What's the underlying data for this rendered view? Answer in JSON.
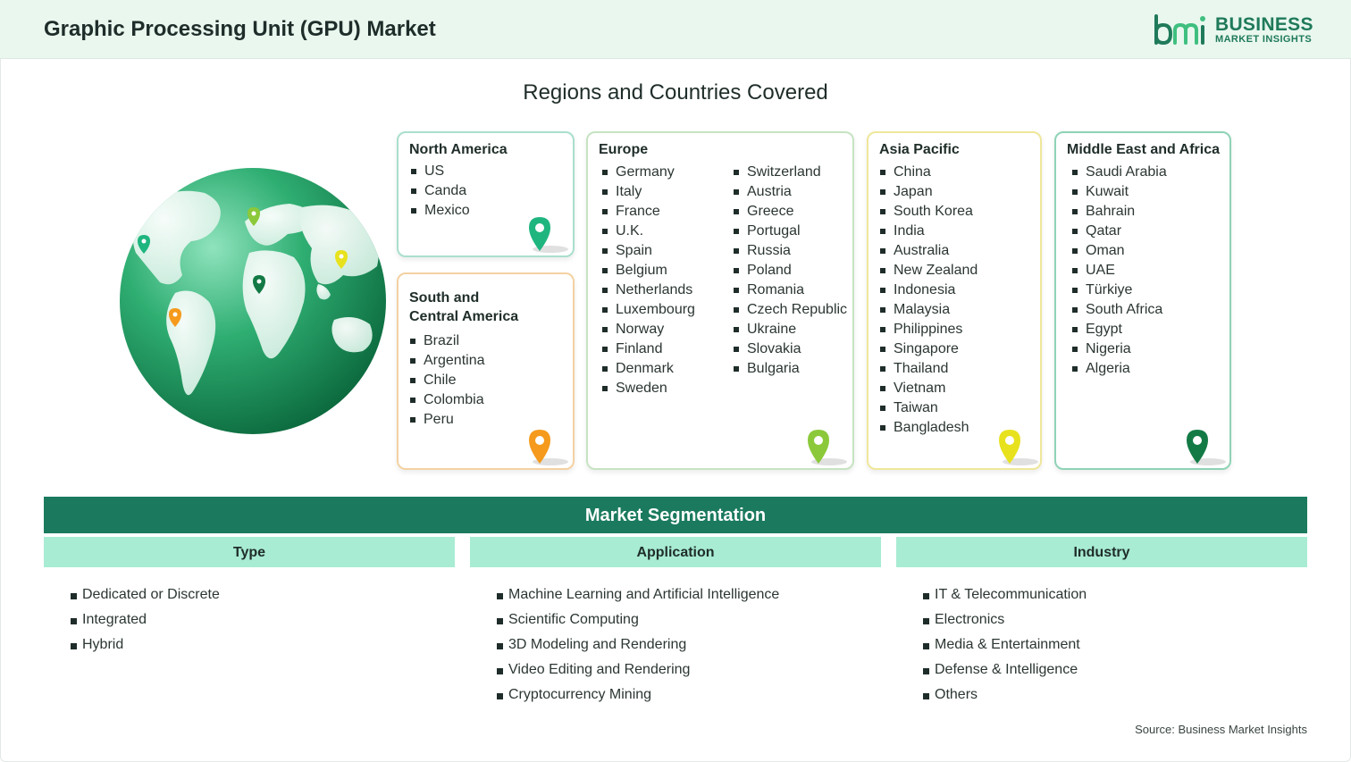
{
  "header": {
    "title": "Graphic Processing Unit (GPU) Market",
    "logo_text_line1": "BUSINESS",
    "logo_text_line2": "MARKET INSIGHTS"
  },
  "regions_title": "Regions and Countries Covered",
  "regions": {
    "north_america": {
      "title": "North America",
      "items": [
        "US",
        "Canda",
        "Mexico"
      ]
    },
    "south_america": {
      "title_line1": "South and",
      "title_line2": "Central America",
      "items": [
        "Brazil",
        "Argentina",
        "Chile",
        "Colombia",
        "Peru"
      ]
    },
    "europe": {
      "title": "Europe",
      "col1": [
        "Germany",
        "Italy",
        "France",
        "U.K.",
        "Spain",
        "Belgium",
        "Netherlands",
        "Luxembourg",
        "Norway",
        "Finland",
        "Denmark",
        "Sweden"
      ],
      "col2": [
        "Switzerland",
        "Austria",
        "Greece",
        "Portugal",
        "Russia",
        "Poland",
        "Romania",
        "Czech Republic",
        "Ukraine",
        "Slovakia",
        "Bulgaria"
      ]
    },
    "asia_pacific": {
      "title": "Asia Pacific",
      "items": [
        "China",
        "Japan",
        "South Korea",
        "India",
        "Australia",
        "New Zealand",
        "Indonesia",
        "Malaysia",
        "Philippines",
        "Singapore",
        "Thailand",
        "Vietnam",
        "Taiwan",
        "Bangladesh"
      ]
    },
    "middle_east_africa": {
      "title": "Middle East and Africa",
      "items": [
        "Saudi Arabia",
        "Kuwait",
        "Bahrain",
        "Qatar",
        "Oman",
        "UAE",
        "Türkiye",
        "South Africa",
        "Egypt",
        "Nigeria",
        "Algeria"
      ]
    }
  },
  "segmentation": {
    "title": "Market Segmentation",
    "type": {
      "title": "Type",
      "items": [
        "Dedicated or Discrete",
        "Integrated",
        "Hybrid"
      ]
    },
    "application": {
      "title": "Application",
      "items": [
        "Machine Learning and Artificial Intelligence",
        "Scientific Computing",
        "3D Modeling and Rendering",
        "Video Editing and Rendering",
        "Cryptocurrency Mining"
      ]
    },
    "industry": {
      "title": "Industry",
      "items": [
        "IT & Telecommunication",
        "Electronics",
        "Media & Entertainment",
        "Defense & Intelligence",
        "Others"
      ]
    }
  },
  "source": "Source: Business Market Insights",
  "colors": {
    "brand_green": "#1b7a5e",
    "header_bg": "#e9f7ef",
    "segment_head": "#a8ecd3",
    "pin_teal": "#1fb57f",
    "pin_orange": "#f59a1c",
    "pin_lime": "#8bc93a",
    "pin_yellow": "#e7e21d",
    "pin_dark_green": "#137a45"
  },
  "icons": [
    "globe-icon",
    "map-pin-icon",
    "bmi-logo-icon"
  ]
}
